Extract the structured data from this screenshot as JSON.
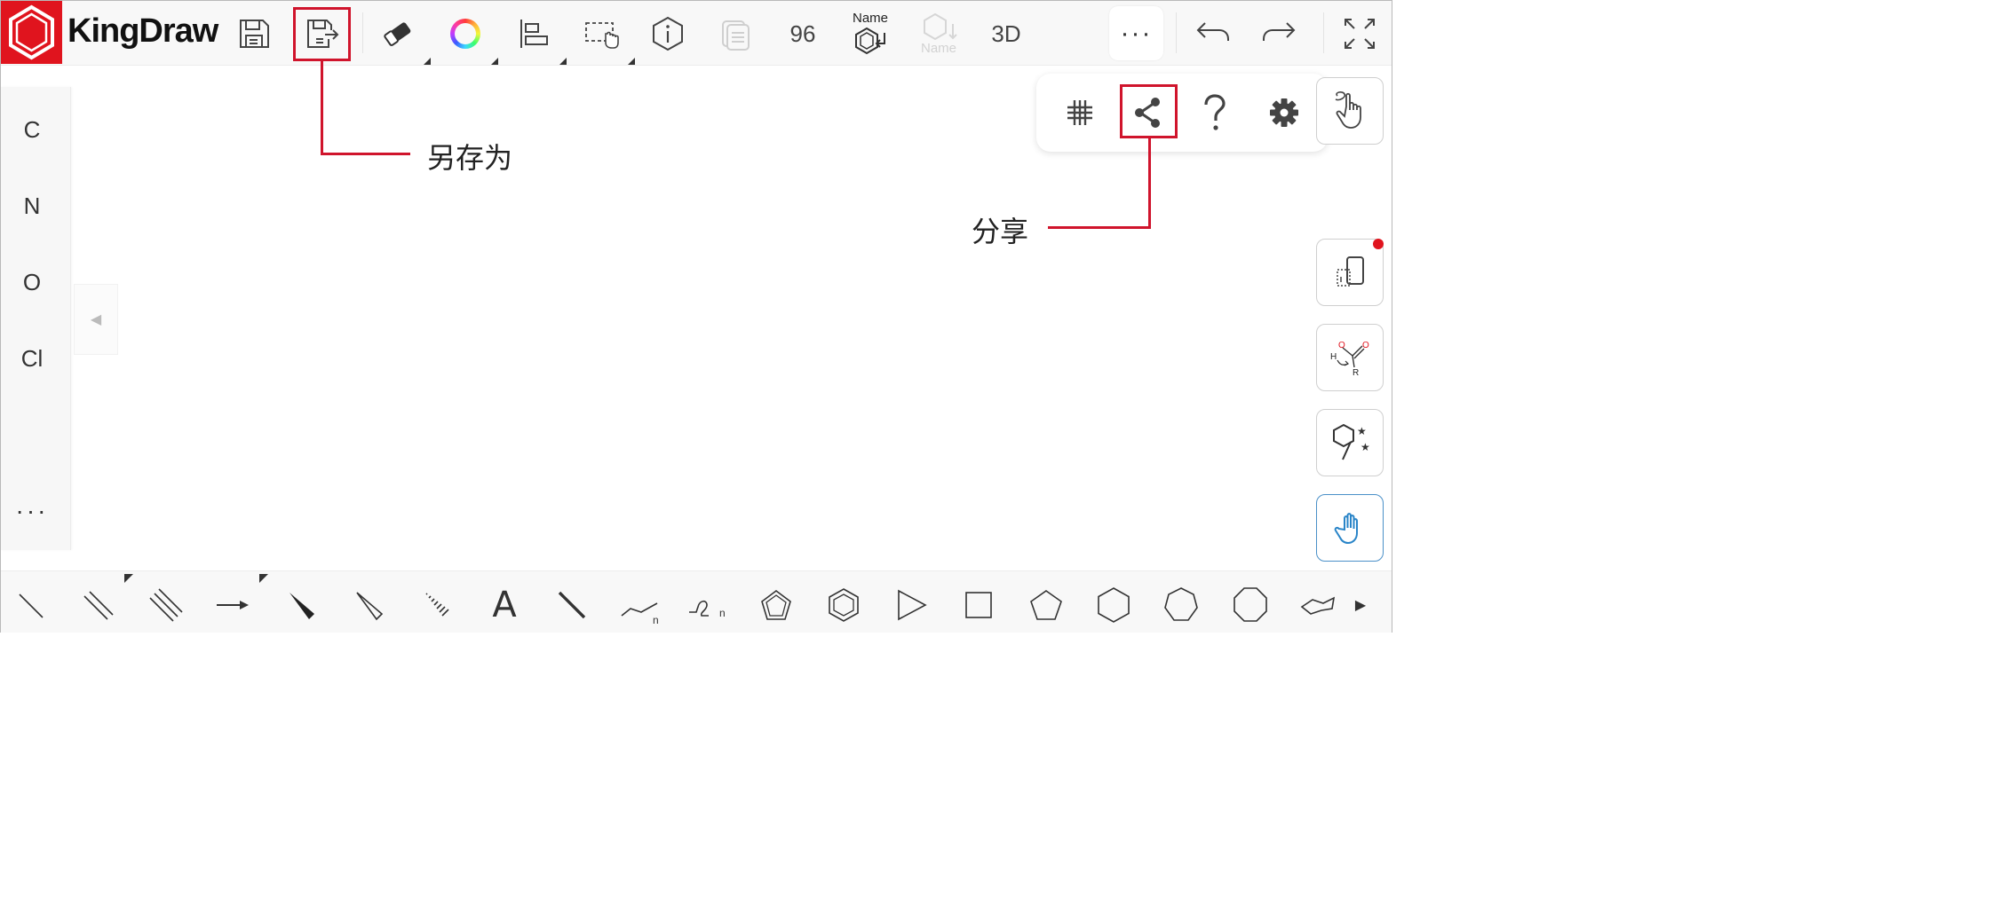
{
  "app": {
    "title": "KingDraw"
  },
  "toolbar": {
    "counter_value": "96",
    "name_tool_label": "Name",
    "name_tool_disabled_label": "Name",
    "three_d_label": "3D",
    "more_label": "···"
  },
  "popup": {
    "items": [
      "grid-icon",
      "share-icon",
      "help-icon",
      "settings-icon"
    ]
  },
  "elements": {
    "items": [
      "C",
      "N",
      "O",
      "Cl"
    ],
    "more_label": "···"
  },
  "right_tools": {
    "reaction_labels": {
      "h": "H",
      "o1": "O",
      "o2": "O",
      "r": "R"
    }
  },
  "bottom_tools": {
    "text_tool_label": "A",
    "chain_subscript": "n",
    "chain2_subscript": "n"
  },
  "annotations": {
    "save_as": "另存为",
    "share": "分享"
  },
  "colors": {
    "accent": "#e0141e",
    "highlight": "#d0142c",
    "active_blue": "#4a90c8"
  }
}
